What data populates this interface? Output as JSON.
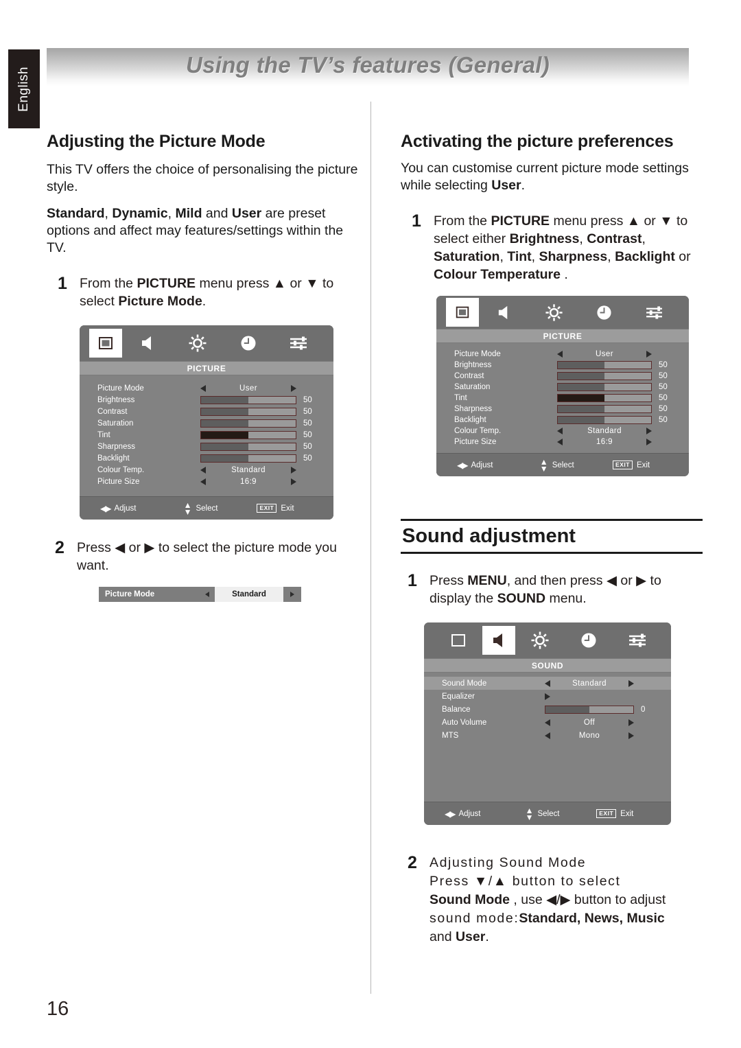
{
  "page": {
    "language_tab": "English",
    "header_title": "Using the TV’s features (General)",
    "page_number": "16"
  },
  "left": {
    "heading": "Adjusting the Picture Mode",
    "lead": "This TV offers the choice of personalising the picture style.",
    "para2_parts": {
      "b1": "Standard",
      "s1": ", ",
      "b2": "Dynamic",
      "s2": ", ",
      "b3": "Mild",
      "s3": " and ",
      "b4": "User",
      "s4": " are preset options and affect may features/settings within the TV."
    },
    "step1": {
      "num": "1",
      "t1": "From the ",
      "b1": "PICTURE",
      "t2": " menu press ▲ or ▼ to select ",
      "b2": "Picture Mode",
      "t3": "."
    },
    "step2": {
      "num": "2",
      "text": "Press ◀ or ▶ to select the picture mode you want."
    },
    "mini_bar": {
      "label": "Picture Mode",
      "value": "Standard"
    }
  },
  "right": {
    "heading": "Activating the picture preferences",
    "lead_parts": {
      "t1": "You can customise current picture mode settings while selecting ",
      "b1": "User",
      "t2": "."
    },
    "step1": {
      "num": "1",
      "t1": "From the ",
      "b1": "PICTURE",
      "t2": " menu press ▲ or ▼ to select either ",
      "b2": "Brightness",
      "t3": ", ",
      "b3": "Contrast",
      "t4": ", ",
      "b4": "Saturation",
      "t5": ", ",
      "b5": "Tint",
      "t6": ", ",
      "b6": "Sharpness",
      "t7": ", ",
      "b7": "Backlight",
      "t8": " or ",
      "b8": "Colour Temperature",
      "t9": " ."
    },
    "sound_section": {
      "heading": "Sound adjustment",
      "step1": {
        "num": "1",
        "t1": "Press ",
        "b1": "MENU",
        "t2": ", and then press ◀ or ▶ to display the ",
        "b2": "SOUND",
        "t3": " menu."
      },
      "step2": {
        "num": "2",
        "line1": "Adjusting Sound Mode",
        "line2": "Press ▼/▲  button to select",
        "line3_b": "Sound Mode",
        "line3_t": " , use ◀/▶ button to adjust",
        "line4_t": "sound  mode:",
        "line4_b": "Standard, News, Music",
        "line5_t": "and ",
        "line5_b": "User",
        "line5_t2": "."
      }
    }
  },
  "osd_icons": [
    {
      "name": "picture-icon",
      "glyph": "square"
    },
    {
      "name": "speaker-icon",
      "glyph": "speaker"
    },
    {
      "name": "brightness-sun-icon",
      "glyph": "sun"
    },
    {
      "name": "clock-icon",
      "glyph": "clock"
    },
    {
      "name": "sliders-icon",
      "glyph": "sliders"
    }
  ],
  "osd_footer": {
    "adjust": "Adjust",
    "select": "Select",
    "exit_key": "EXIT",
    "exit": "Exit"
  },
  "picture_menu": {
    "title": "PICTURE",
    "active_icon_index": 0,
    "rows": [
      {
        "label": "Picture Mode",
        "type": "option",
        "value": "User"
      },
      {
        "label": "Brightness",
        "type": "slider",
        "value": "50",
        "fill": 50,
        "dark": false
      },
      {
        "label": "Contrast",
        "type": "slider",
        "value": "50",
        "fill": 50,
        "dark": false
      },
      {
        "label": "Saturation",
        "type": "slider",
        "value": "50",
        "fill": 50,
        "dark": false
      },
      {
        "label": "Tint",
        "type": "slider",
        "value": "50",
        "fill": 50,
        "dark": true
      },
      {
        "label": "Sharpness",
        "type": "slider",
        "value": "50",
        "fill": 50,
        "dark": false
      },
      {
        "label": "Backlight",
        "type": "slider",
        "value": "50",
        "fill": 50,
        "dark": false
      },
      {
        "label": "Colour Temp.",
        "type": "option",
        "value": "Standard"
      },
      {
        "label": "Picture Size",
        "type": "option",
        "value": "16:9"
      }
    ]
  },
  "sound_menu": {
    "title": "SOUND",
    "active_icon_index": 1,
    "rows": [
      {
        "label": "Sound Mode",
        "type": "option",
        "value": "Standard",
        "highlight": true
      },
      {
        "label": "Equalizer",
        "type": "submenu",
        "value": ""
      },
      {
        "label": "Balance",
        "type": "slider",
        "value": "0",
        "fill": 50,
        "dark": false
      },
      {
        "label": "Auto Volume",
        "type": "option",
        "value": "Off"
      },
      {
        "label": "MTS",
        "type": "option",
        "value": "Mono"
      }
    ]
  }
}
